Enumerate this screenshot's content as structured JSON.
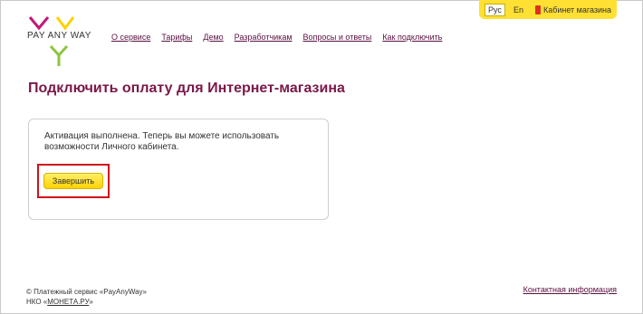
{
  "topbar": {
    "lang_ru": "Рус",
    "lang_en": "En",
    "cabinet_label": "Кабинет магазина"
  },
  "logo": {
    "text": "PAY ANY WAY",
    "colors": {
      "magenta": "#c2187a",
      "yellow": "#ffd000",
      "green": "#8cc63f"
    }
  },
  "nav": {
    "items": [
      "О сервисе",
      "Тарифы",
      "Демо",
      "Разработчикам",
      "Вопросы и ответы",
      "Как подключить"
    ]
  },
  "page": {
    "title": "Подключить оплату для Интернет-магазина",
    "message": "Активация выполнена. Теперь вы можете использовать возможности Личного кабинета.",
    "finish_button": "Завершить"
  },
  "footer": {
    "copyright_line": "© Платежный сервис «PayAnyWay»",
    "nko_prefix": "НКО «",
    "nko_link": "МОНЕТА.РУ",
    "nko_suffix": "»",
    "contacts": "Контактная информация"
  },
  "colors": {
    "title": "#7a1848",
    "nav_link": "#5a1040",
    "topbar_bg": "#ffe033",
    "button_bg": "#ffd200",
    "highlight_border": "#d0101a"
  }
}
